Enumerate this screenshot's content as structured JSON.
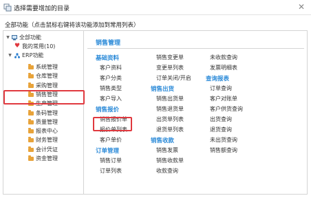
{
  "window": {
    "title": "选择需要增加的目录",
    "close_glyph": "✕"
  },
  "subheader": "全部功能（点击鼠标右键将该功能添加到常用列表）",
  "tree": {
    "root": "全部功能",
    "favorites": "我的常用(10)",
    "erp": "ERP功能",
    "items": [
      "系统管理",
      "仓库管理",
      "采购管理",
      "销售管理",
      "生产管理",
      "条码管理",
      "质量管理",
      "报表中心",
      "财务管理",
      "会计凭证",
      "资金管理"
    ],
    "selected": "销售管理"
  },
  "main": {
    "title": "销售管理",
    "columns": [
      {
        "sections": [
          {
            "title": "基础资料",
            "items": [
              "客户资料",
              "客户分类",
              "销售类型",
              "客户导入"
            ]
          },
          {
            "title": "销售报价",
            "items": [
              "销售报价单",
              "报价单列表",
              "客户单价"
            ]
          },
          {
            "title": "订单管理",
            "items": [
              "销售订单",
              "订单列表"
            ]
          }
        ]
      },
      {
        "sections": [
          {
            "title": "",
            "items": [
              "销售变更单",
              "变更单列表",
              "订单关闭/开启"
            ]
          },
          {
            "title": "销售出货",
            "items": [
              "销售出货单",
              "销售退货单",
              "出货单列表",
              "退货单列表"
            ]
          },
          {
            "title": "销售收款",
            "items": [
              "销售发票",
              "销售收款单",
              "收款查询"
            ]
          }
        ]
      },
      {
        "sections": [
          {
            "title": "",
            "items": [
              "未收款查询",
              "发票明细表"
            ]
          },
          {
            "title": "查询报表",
            "items": [
              "订单查询",
              "客户对账单",
              "客户供货查询",
              "出货查询",
              "退货查询",
              "未出货查询",
              "销售额查询"
            ]
          }
        ]
      }
    ]
  },
  "highlighted_item": "销售报价单",
  "colors": {
    "accent": "#2b8ad8",
    "highlight": "#e0383e",
    "folder": "#e8a33a",
    "heart": "#e0383e"
  }
}
